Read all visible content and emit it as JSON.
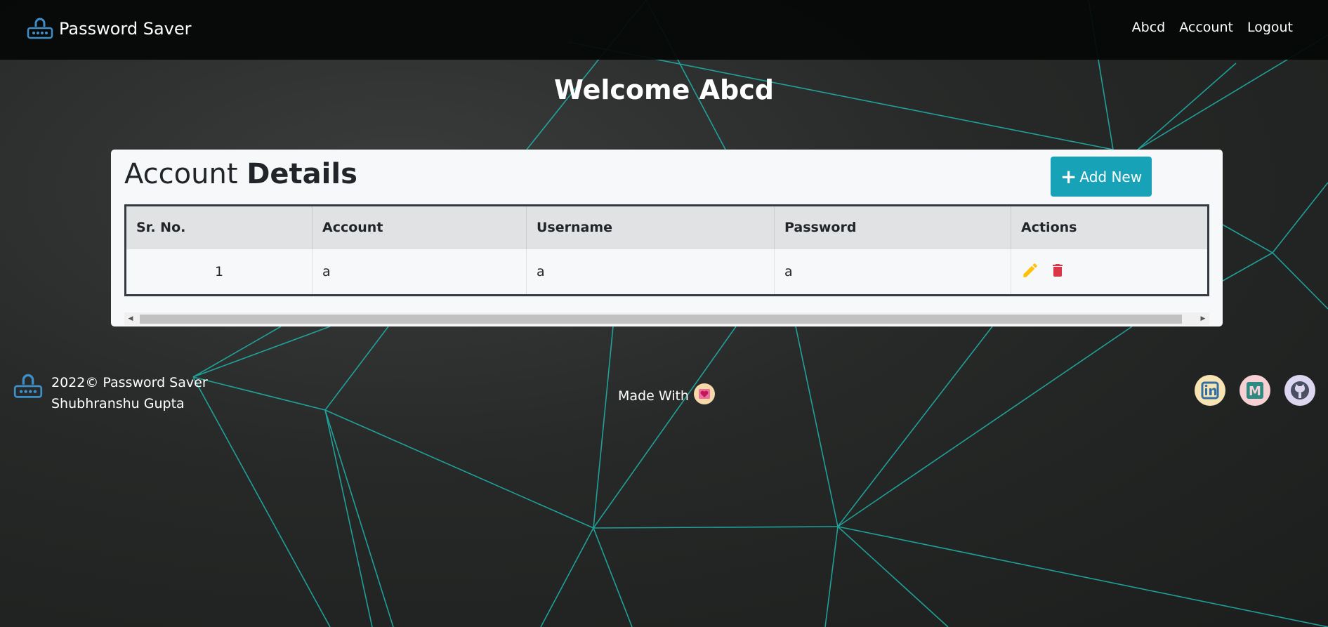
{
  "navbar": {
    "brand": "Password Saver",
    "links": [
      "Abcd",
      "Account",
      "Logout"
    ]
  },
  "welcome": "Welcome Abcd",
  "card": {
    "title_regular": "Account ",
    "title_bold": "Details",
    "add_button_label": "Add New",
    "table": {
      "headers": [
        "Sr. No.",
        "Account",
        "Username",
        "Password",
        "Actions"
      ],
      "rows": [
        {
          "sr": "1",
          "account": "a",
          "username": "a",
          "password": "a"
        }
      ]
    }
  },
  "footer": {
    "copyright": "2022© Password Saver",
    "author": "Shubhranshu Gupta",
    "made_with": "Made With",
    "socials": [
      "linkedin-icon",
      "medium-icon",
      "github-icon"
    ]
  },
  "colors": {
    "accent": "#17a2b8",
    "edit": "#ffc107",
    "delete": "#dc3545",
    "lines": "#1fb5ad"
  }
}
